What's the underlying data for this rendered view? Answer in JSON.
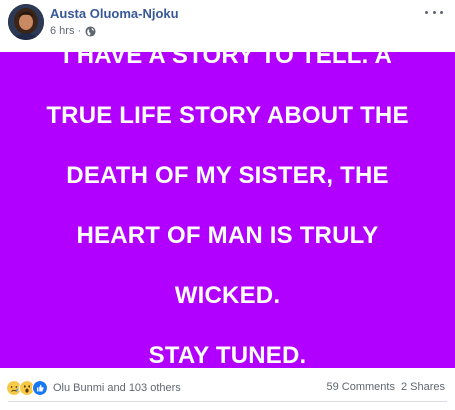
{
  "post": {
    "author": "Austa Oluoma-Njoku",
    "timestamp": "6 hrs",
    "separator": "·",
    "privacy_icon": "globe-icon",
    "more_icon": "more-options-icon",
    "background_color": "#b100ff",
    "text_lines": [
      "I HAVE A STORY TO TELL. A",
      "TRUE LIFE STORY ABOUT THE",
      "DEATH OF MY SISTER, THE",
      "HEART OF MAN IS TRULY",
      "WICKED.",
      "STAY TUNED."
    ]
  },
  "footer": {
    "reaction_icons": [
      "sad-reaction-icon",
      "wow-reaction-icon",
      "like-reaction-icon"
    ],
    "reactors": "Olu Bunmi and 103 others",
    "comments": "59 Comments",
    "shares": "2 Shares"
  }
}
